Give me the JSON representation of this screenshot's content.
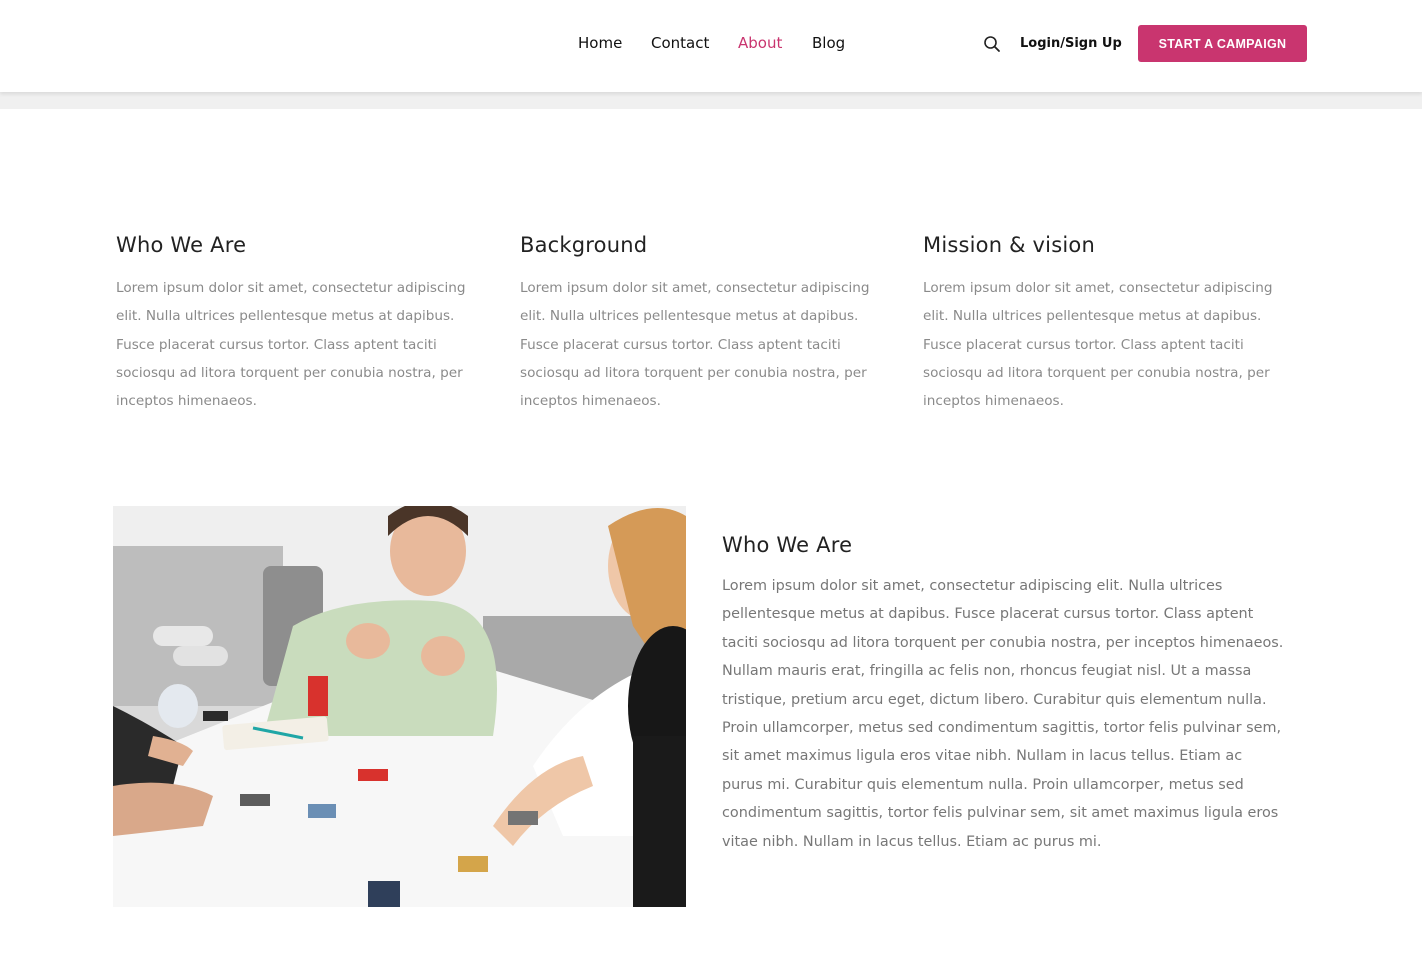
{
  "nav": {
    "items": [
      {
        "label": "Home",
        "active": false
      },
      {
        "label": "Contact",
        "active": false
      },
      {
        "label": "About",
        "active": true
      },
      {
        "label": "Blog",
        "active": false
      }
    ],
    "login_label": "Login/Sign Up",
    "cta_label": "START A CAMPAIGN",
    "search_icon": "search-icon"
  },
  "columns": [
    {
      "title": "Who We Are",
      "text": "Lorem ipsum dolor sit amet, consectetur adipiscing elit. Nulla ultrices pellentesque metus at dapibus. Fusce placerat cursus tortor. Class aptent taciti sociosqu ad litora torquent per conubia nostra, per inceptos himenaeos."
    },
    {
      "title": "Background",
      "text": "Lorem ipsum dolor sit amet, consectetur adipiscing elit. Nulla ultrices pellentesque metus at dapibus. Fusce placerat cursus tortor. Class aptent taciti sociosqu ad litora torquent per conubia nostra, per inceptos himenaeos."
    },
    {
      "title": "Mission & vision",
      "text": "Lorem ipsum dolor sit amet, consectetur adipiscing elit. Nulla ultrices pellentesque metus at dapibus. Fusce placerat cursus tortor. Class aptent taciti sociosqu ad litora torquent per conubia nostra, per inceptos himenaeos."
    }
  ],
  "about": {
    "title": "Who We Are",
    "text": "Lorem ipsum dolor sit amet, consectetur adipiscing elit. Nulla ultrices pellentesque metus at dapibus. Fusce placerat cursus tortor. Class aptent taciti sociosqu ad litora torquent per conubia nostra, per inceptos himenaeos. Nullam mauris erat, fringilla ac felis non, rhoncus feugiat nisl. Ut a massa tristique, pretium arcu eget, dictum libero. Curabitur quis elementum nulla. Proin ullamcorper, metus sed condimentum sagittis, tortor felis pulvinar sem, sit amet maximus ligula eros vitae nibh. Nullam in lacus tellus. Etiam ac purus mi. Curabitur quis elementum nulla. Proin ullamcorper, metus sed condimentum sagittis, tortor felis pulvinar sem, sit amet maximus ligula eros vitae nibh. Nullam in lacus tellus. Etiam ac purus mi."
  },
  "colors": {
    "accent": "#c9356f",
    "heading": "#222222",
    "body_text": "#8a8a8a",
    "header_bg": "#ffffff",
    "band_bg": "#f0f0f0"
  }
}
